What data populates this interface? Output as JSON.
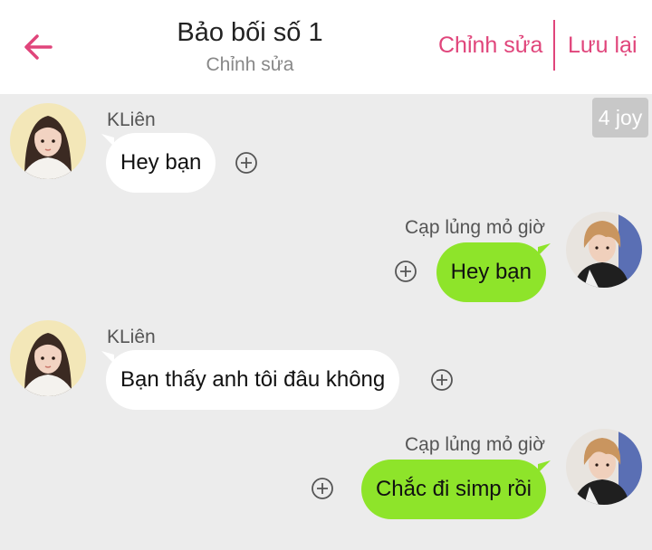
{
  "header": {
    "title": "Bảo bối số 1",
    "subtitle": "Chỉnh sửa",
    "edit_label": "Chỉnh sửa",
    "save_label": "Lưu lại"
  },
  "badge": "4 joy",
  "colors": {
    "accent": "#e0457b",
    "bubble_left": "#ffffff",
    "bubble_right": "#8ee42a",
    "background": "#ececec"
  },
  "messages": [
    {
      "sender": "KLiên",
      "text": "Hey bạn",
      "side": "left"
    },
    {
      "sender": "Cạp lủng mỏ giờ",
      "text": "Hey bạn",
      "side": "right"
    },
    {
      "sender": "KLiên",
      "text": "Bạn thấy anh tôi đâu không",
      "side": "left"
    },
    {
      "sender": "Cạp lủng mỏ giờ",
      "text": "Chắc đi simp rồi",
      "side": "right"
    }
  ]
}
